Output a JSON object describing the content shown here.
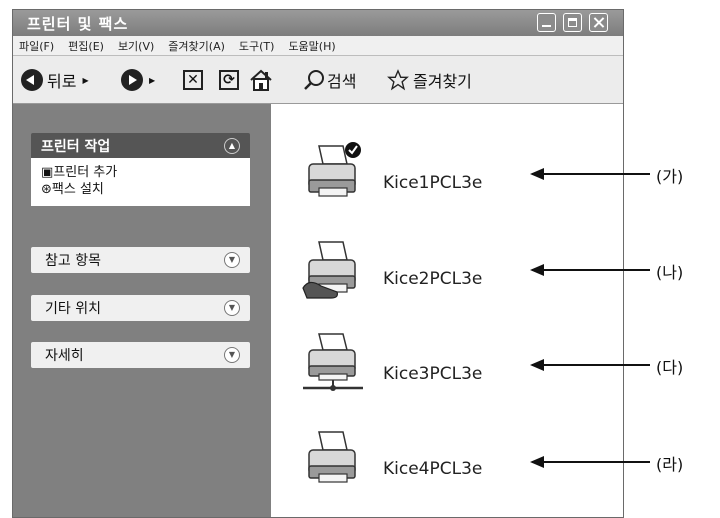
{
  "window": {
    "title": "프린터 및 팩스"
  },
  "menu": [
    {
      "label": "파일(F)"
    },
    {
      "label": "편집(E)"
    },
    {
      "label": "보기(V)"
    },
    {
      "label": "즐겨찾기(A)"
    },
    {
      "label": "도구(T)"
    },
    {
      "label": "도움말(H)"
    }
  ],
  "toolbar": {
    "back_label": "뒤로",
    "search_label": "검색",
    "favorites_label": "즐겨찾기"
  },
  "sidebar": {
    "task_panel": {
      "title": "프린터 작업",
      "items": [
        {
          "icon": "add-printer-icon",
          "label": "프린터 추가"
        },
        {
          "icon": "fax-icon",
          "label": "팩스 설치"
        }
      ]
    },
    "collapsed_panels": [
      {
        "label": "참고 항목"
      },
      {
        "label": "기타 위치"
      },
      {
        "label": "자세히"
      }
    ]
  },
  "printers": [
    {
      "name": "Kice1PCL3e",
      "icon": "default-printer-icon",
      "callout": "(가)"
    },
    {
      "name": "Kice2PCL3e",
      "icon": "shared-printer-icon",
      "callout": "(나)"
    },
    {
      "name": "Kice3PCL3e",
      "icon": "network-printer-icon",
      "callout": "(다)"
    },
    {
      "name": "Kice4PCL3e",
      "icon": "printer-icon",
      "callout": "(라)"
    }
  ]
}
